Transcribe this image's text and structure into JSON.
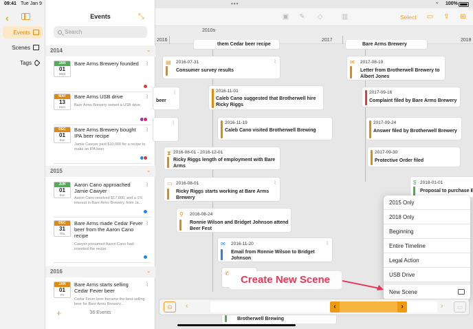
{
  "status": {
    "time": "09:41",
    "date": "Tue Jan 9",
    "battery": "100%"
  },
  "nav": {
    "items": [
      {
        "label": "Events",
        "icon": "calendar-icon",
        "active": true
      },
      {
        "label": "Scenes",
        "icon": "scenes-icon",
        "active": false
      },
      {
        "label": "Tags",
        "icon": "tag-icon",
        "active": false
      }
    ]
  },
  "events_panel": {
    "title": "Events",
    "search_placeholder": "Search",
    "footer_count": "36 Events",
    "groups": [
      {
        "year": "2014",
        "events": [
          {
            "month": "JAN",
            "day": "01",
            "dow": "Wed",
            "month_color": "#4caf50",
            "title": "Bare Arms Brewery founded",
            "desc": "",
            "dots": [
              "#e53935"
            ]
          },
          {
            "month": "MAY",
            "day": "13",
            "dow": "Mon",
            "month_color": "#e08a10",
            "title": "Bare Arms USB drive",
            "desc": "Bare Arms Brewery owned a USB drive.",
            "dots": [
              "#9c27b0",
              "#e91e63"
            ]
          },
          {
            "month": "DEC",
            "day": "01",
            "dow": "Sun",
            "month_color": "#e08a10",
            "title": "Bare Arms Brewery bought IPA beer recipe",
            "desc": "Jamie Cawyer paid $10,000 for a recipe to make an IPA beer.",
            "dots": [
              "#1e88e5",
              "#e53935"
            ]
          }
        ]
      },
      {
        "year": "2015",
        "events": [
          {
            "month": "JUN",
            "day": "01",
            "dow": "Sun",
            "month_color": "#4caf50",
            "title": "Aaron Cano approached Jamie Cawyer",
            "desc": "Aaron Cano received $17,000, and a 1% interest in Bare Arms Brewery, from Ja...",
            "dots": [
              "#1e88e5"
            ]
          },
          {
            "month": "DEC",
            "day": "31",
            "dow": "Thu",
            "month_color": "#e08a10",
            "title": "Bare Arms made Cedar Fever beer from the Aaron Cano recipe",
            "desc": "Cawyer presumed Aaron Cano had invented the recipe.",
            "dots": [
              "#1e88e5"
            ]
          }
        ]
      },
      {
        "year": "2016",
        "events": [
          {
            "month": "JAN",
            "day": "01",
            "dow": "Fri",
            "month_color": "#e08a10",
            "title": "Bare Arms starts selling Cedar Fever beer",
            "desc": "Cedar Fever beer became the best-selling beer for Bare Arms Brewery...",
            "dots": []
          }
        ]
      }
    ]
  },
  "toolbar": {
    "select_label": "Select"
  },
  "ruler": {
    "decade": "2010s",
    "years": [
      "2016",
      "2017",
      "2018"
    ]
  },
  "cards": [
    {
      "date": "",
      "title": "them Cedar beer recipe",
      "bar": "#e08a10"
    },
    {
      "date": "",
      "title": "Bare Arms Brewery",
      "bar": "#e08a10"
    },
    {
      "date": "2016-07-31",
      "title": "Consumer survey results",
      "bar": "#e08a10",
      "icon": "clipboard-icon"
    },
    {
      "date": "2017-08-19",
      "title": "Letter from Brotherwell Brewery to Albert Jones",
      "bar": "#e08a10",
      "icon": "envelope-icon"
    },
    {
      "date": "",
      "title": "beer",
      "bar": "#e08a10"
    },
    {
      "date": "2016-11-01",
      "title": "Caleb Cano suggested that Brotherwell hire Ricky Riggs",
      "bar": "#e08a10"
    },
    {
      "date": "2017-09-16",
      "title": "Complaint filed by Bare Arms Brewery",
      "bar": "#e53935"
    },
    {
      "date": "2016-11-19",
      "title": "Caleb Cano visited Brotherwell Brewing",
      "bar": "#e08a10"
    },
    {
      "date": "2017-09-24",
      "title": "Answer filed by Brotherwell Brewery",
      "bar": "#e08a10"
    },
    {
      "date": "2016-08-01 - 2016-12-01",
      "title": "Ricky Riggs length of employment with Bare Arms",
      "bar": "#e08a10",
      "icon": "hourglass-icon"
    },
    {
      "date": "2017-09-30",
      "title": "Protective Order filed",
      "bar": "#e08a10"
    },
    {
      "date": "2016-08-01",
      "title": "Ricky Riggs starts working at Bare Arms Brewery",
      "bar": "#e08a10",
      "icon": "calendar-icon"
    },
    {
      "date": "2018-01-01",
      "title": "Proposal to purchase B",
      "bar": "#4caf50",
      "icon": "dollar-icon"
    },
    {
      "date": "2016-08-24",
      "title": "Ronnie Wilson and Bridget Johnson attend Beer Fest",
      "bar": "#e08a10",
      "icon": "person-icon"
    },
    {
      "date": "2016-11-20",
      "title": "Email from Ronnie Wilson to Bridget Johnson",
      "bar": "#1e88e5",
      "icon": "envelope-icon"
    },
    {
      "date": "",
      "title": "Brotherwell Brewing",
      "bar": "#4caf50"
    }
  ],
  "scene_menu": {
    "items": [
      "2015 Only",
      "2018 Only",
      "Beginning",
      "Entire Timeline",
      "Legal Action",
      "USB Drive"
    ],
    "new_scene": "New Scene"
  },
  "callout": "Create New Scene"
}
